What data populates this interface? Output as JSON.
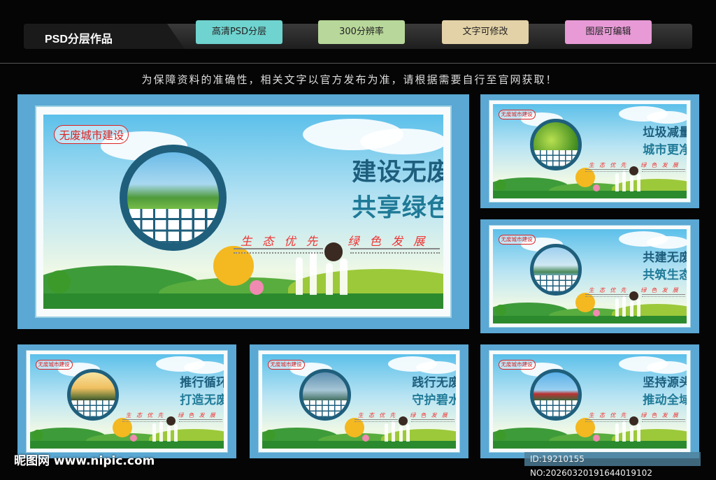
{
  "header": {
    "title": "PSD分层作品",
    "tags": [
      {
        "label": "高清PSD分层",
        "color": "#6fd3cf"
      },
      {
        "label": "300分辨率",
        "color": "#b8d79a"
      },
      {
        "label": "文字可修改",
        "color": "#e3d2a7"
      },
      {
        "label": "图层可编辑",
        "color": "#e79ad6"
      }
    ]
  },
  "notice": "为保障资料的准确性，相关文字以官方发布为准，请根据需要自行至官网获取！",
  "panels": [
    {
      "stamp": "无废城市建设",
      "line1": "建设无废城市",
      "line2": "共享绿色家园",
      "slogan_left": "生态优先",
      "slogan_right": "绿色发展"
    },
    {
      "stamp": "无废城市建设",
      "line1": "垃圾减量分类",
      "line2": "城市更净更美",
      "slogan_left": "生态优先",
      "slogan_right": "绿色发展"
    },
    {
      "stamp": "无废城市建设",
      "line1": "共建无废城市",
      "line2": "共筑生态屏障",
      "slogan_left": "生态优先",
      "slogan_right": "绿色发展"
    },
    {
      "stamp": "无废城市建设",
      "line1": "推行循环利用",
      "line2": "打造无废之城",
      "slogan_left": "生态优先",
      "slogan_right": "绿色发展"
    },
    {
      "stamp": "无废城市建设",
      "line1": "践行无废理念",
      "line2": "守护碧水蓝天",
      "slogan_left": "生态优先",
      "slogan_right": "绿色发展"
    },
    {
      "stamp": "无废城市建设",
      "line1": "坚持源头减量",
      "line2": "推动全域无废",
      "slogan_left": "生态优先",
      "slogan_right": "绿色发展"
    }
  ],
  "watermark": "昵图网 www.nipic.com",
  "image_id": "ID:19210155 NO:20260320191644019102"
}
